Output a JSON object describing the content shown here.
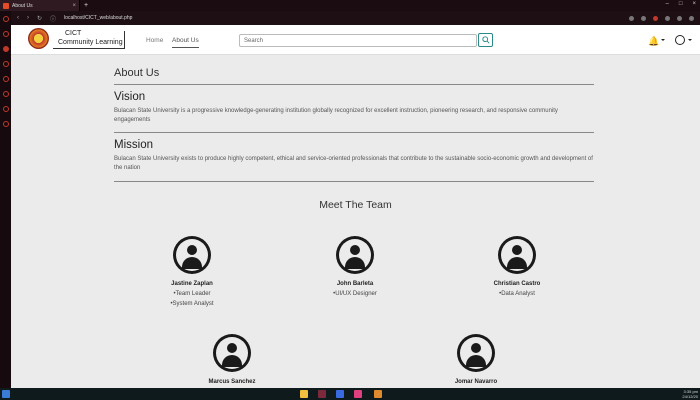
{
  "browser": {
    "tab_title": "About Us",
    "url": "localhost/CICT_web/about.php"
  },
  "header": {
    "brand_line1": "CICT",
    "brand_line2": "Community Learning",
    "nav": [
      {
        "label": "Home"
      },
      {
        "label": "About Us"
      }
    ],
    "search_placeholder": "Search"
  },
  "about": {
    "title": "About Us",
    "vision_title": "Vision",
    "vision_text": "Bulacan State University is a progressive knowledge-generating institution globally recognized for excellent instruction, pioneering research, and responsive community engagements",
    "mission_title": "Mission",
    "mission_text": "Bulacan State University exists to produce highly competent, ethical and service-oriented professionals that contribute to the sustainable socio-economic growth and development of the nation"
  },
  "team": {
    "title": "Meet The Team",
    "members": [
      {
        "name": "Jastine Zaplan",
        "roles": [
          "•Team Leader",
          "•System Analyst"
        ]
      },
      {
        "name": "John Barleta",
        "roles": [
          "•UI/UX Designer"
        ]
      },
      {
        "name": "Christian Castro",
        "roles": [
          "•Data Analyst"
        ]
      },
      {
        "name": "Marcus Sanchez",
        "roles": []
      },
      {
        "name": "Jomar Navarro",
        "roles": []
      }
    ]
  },
  "taskbar": {
    "time": "3:35 pm",
    "date": "24/12/20"
  },
  "colors": {
    "accent": "#2a8a88",
    "browser_red": "#c0392b"
  }
}
